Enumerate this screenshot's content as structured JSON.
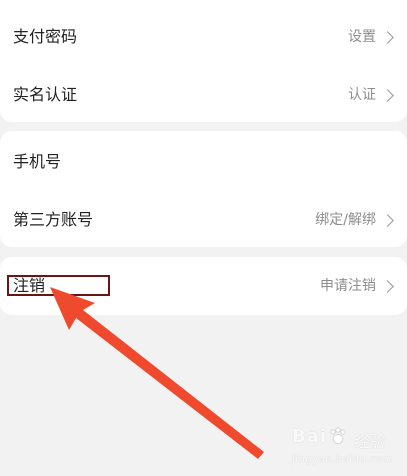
{
  "security_group": {
    "rows": [
      {
        "label": "支付密码",
        "value": "设置"
      },
      {
        "label": "实名认证",
        "value": "认证"
      }
    ]
  },
  "account_group": {
    "rows": [
      {
        "label": "手机号"
      },
      {
        "label": "第三方账号",
        "value": "绑定/解绑"
      }
    ]
  },
  "cancel_group": {
    "rows": [
      {
        "label": "注销",
        "value": "申请注销"
      }
    ]
  },
  "annotation": {
    "box_color": "#6b1414",
    "arrow_color": "#f04a2e"
  },
  "watermark": {
    "brand": "Bai",
    "name": "经验",
    "url": "jingyan.baidu.com"
  }
}
